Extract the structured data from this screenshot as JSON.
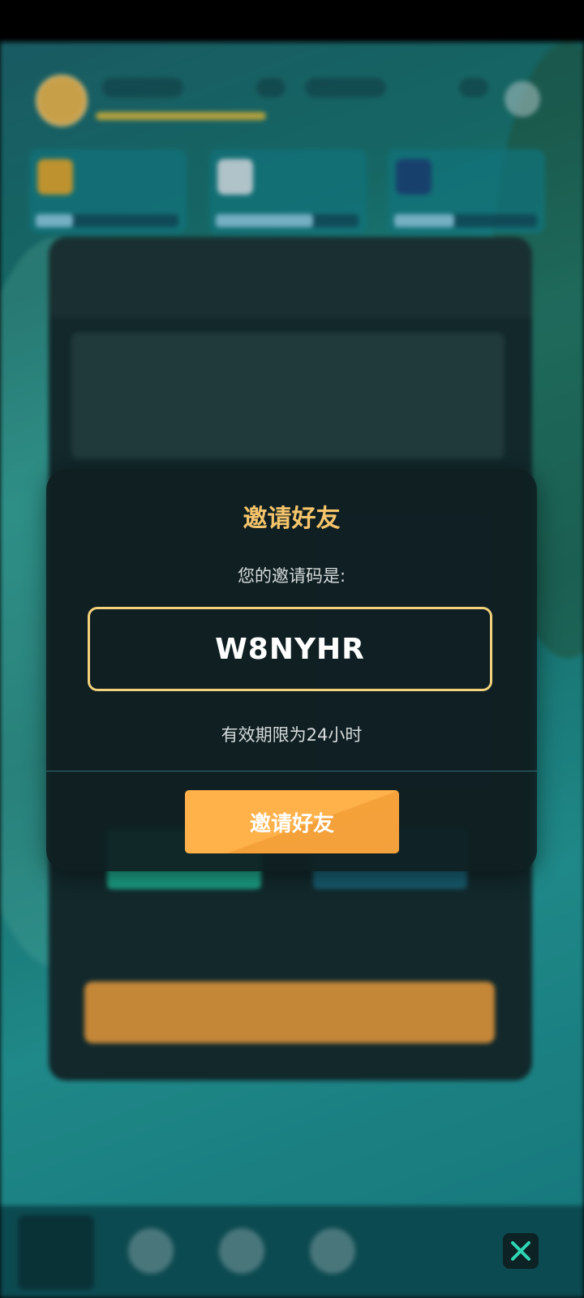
{
  "invite_modal": {
    "title": "邀请好友",
    "code_label": "您的邀请码是:",
    "invite_code": "W8NYHR",
    "expiry_note": "有效期限为24小时",
    "invite_button_label": "邀请好友"
  },
  "colors": {
    "title": "#f6c56b",
    "code_border": "#f2d27b",
    "button": "#ffb14a",
    "close_icon": "#2fd6b4"
  },
  "icons": [
    "close-icon",
    "gear-icon",
    "nav-home-icon"
  ]
}
